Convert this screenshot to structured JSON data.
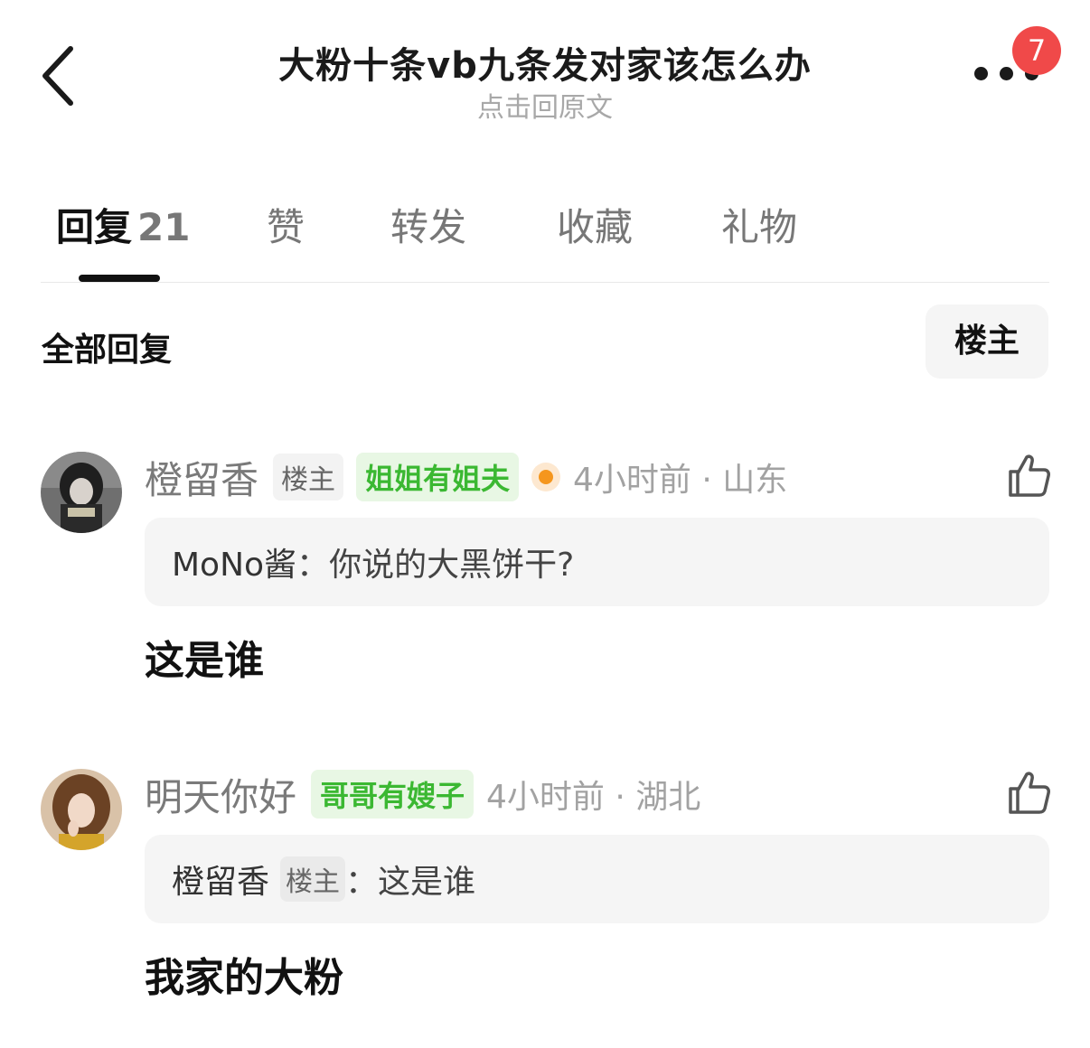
{
  "header": {
    "title": "大粉十条vb九条发对家该怎么办",
    "subtitle": "点击回原文",
    "badge_count": "7",
    "back_icon": "chevron-left-icon",
    "more_icon": "more-horizontal-icon"
  },
  "tabs": [
    {
      "label": "回复",
      "count": "21",
      "active": true
    },
    {
      "label": "赞"
    },
    {
      "label": "转发"
    },
    {
      "label": "收藏"
    },
    {
      "label": "礼物"
    }
  ],
  "filter": {
    "section_title": "全部回复",
    "op_filter_label": "楼主"
  },
  "comments": [
    {
      "username": "橙留香",
      "op_tag": "楼主",
      "relation_tag": "姐姐有姐夫",
      "online_dot_color": "#f5961d",
      "time_location": "4小时前 · 山东",
      "quote_user": "MoNo酱",
      "quote_sep": "：",
      "quote_text": "你说的大黑饼干?",
      "content": "这是谁",
      "like_icon": "thumbs-up-icon"
    },
    {
      "username": "明天你好",
      "relation_tag": "哥哥有嫂子",
      "time_location": "4小时前 · 湖北",
      "quote_user": "橙留香",
      "quote_user_tag": "楼主",
      "quote_sep": "：",
      "quote_text": "这是谁",
      "content": "我家的大粉",
      "like_icon": "thumbs-up-icon"
    }
  ],
  "colors": {
    "badge": "#f04949",
    "green_tag_text": "#3bb832",
    "green_tag_bg": "#e8f7e4",
    "quote_bg": "#f5f5f5",
    "muted_text": "#a2a2a2"
  }
}
